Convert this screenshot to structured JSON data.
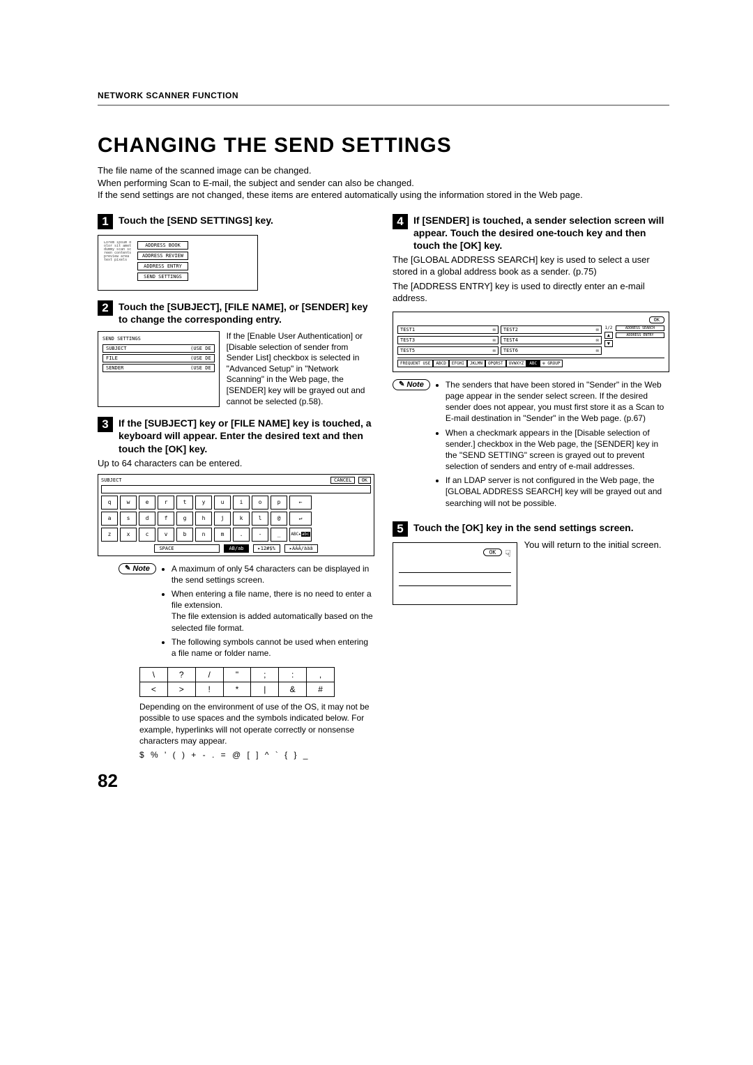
{
  "header": {
    "section": "NETWORK SCANNER FUNCTION"
  },
  "title": "CHANGING THE SEND SETTINGS",
  "intro": {
    "line1": "The file name of the scanned image can be changed.",
    "line2": "When performing Scan to E-mail, the subject and sender can also be changed.",
    "line3": "If the send settings are not changed, these items are entered automatically using the information stored in the Web page."
  },
  "step1": {
    "num": "1",
    "title": "Touch the [SEND SETTINGS] key.",
    "menu": {
      "addressBook": "ADDRESS BOOK",
      "addressReview": "ADDRESS REVIEW",
      "addressEntry": "ADDRESS ENTRY",
      "sendSettings": "SEND SETTINGS"
    }
  },
  "step2": {
    "num": "2",
    "title": "Touch the [SUBJECT], [FILE NAME], or [SENDER] key to change the corresponding entry.",
    "screen": {
      "header": "SEND SETTINGS",
      "subject": "SUBJECT",
      "file": "FILE",
      "sender": "SENDER",
      "placeholder": "(USE DE"
    },
    "text": "If the [Enable User Authentication] or [Disable selection of sender from Sender List] checkbox is selected in \"Advanced Setup\" in \"Network Scanning\" in the Web page, the [SENDER] key will be grayed out and cannot be selected (p.58)."
  },
  "step3": {
    "num": "3",
    "title": "If the [SUBJECT] key or [FILE NAME] key is touched, a keyboard will appear. Enter the desired text and then touch the [OK] key.",
    "caption": "Up to 64 characters can be entered.",
    "keyboard": {
      "title": "SUBJECT",
      "cancel": "CANCEL",
      "ok": "OK",
      "row1": [
        "q",
        "w",
        "e",
        "r",
        "t",
        "y",
        "u",
        "i",
        "o",
        "p"
      ],
      "row2": [
        "a",
        "s",
        "d",
        "f",
        "g",
        "h",
        "j",
        "k",
        "l",
        "@"
      ],
      "row3": [
        "z",
        "x",
        "c",
        "v",
        "b",
        "n",
        "m",
        ".",
        "-",
        "_"
      ],
      "space": "SPACE",
      "mode1": "AB/ab",
      "mode2": "12#$%",
      "mode3": "ÀÄÂ/àäâ",
      "abc": "ABC",
      "abcInv": "abc"
    },
    "note": {
      "label": "Note",
      "items": [
        "A maximum of only 54 characters can be displayed in the send settings screen.",
        "When entering a file name, there is no need to enter a file extension.\nThe file extension is added automatically based on the selected file format.",
        "The following symbols cannot be used when entering a file name or folder name."
      ],
      "symbolsRow1": [
        "\\",
        "?",
        "/",
        "\"",
        ";",
        ":",
        ","
      ],
      "symbolsRow2": [
        "<",
        ">",
        "!",
        "*",
        "|",
        "&",
        "#"
      ],
      "caption": "Depending on the environment of use of the OS, it may not be possible to use spaces and the symbols indicated below. For example, hyperlinks will not operate correctly or nonsense characters may appear.",
      "symbolsLine": "$  %  '  (  )  +  -  .  =  @  [  ]  ^  `  {  }  _"
    }
  },
  "step4": {
    "num": "4",
    "title": "If [SENDER] is touched, a sender selection screen will appear. Touch the desired one-touch key and then touch the [OK] key.",
    "body1": "The [GLOBAL ADDRESS SEARCH] key is used to select a user stored in a global address book as a sender. (p.75)",
    "body2": "The [ADDRESS ENTRY] key is used to directly enter an e-mail address.",
    "screen": {
      "ok": "OK",
      "test1": "TEST1",
      "test2": "TEST2",
      "test3": "TEST3",
      "test4": "TEST4",
      "test5": "TEST5",
      "test6": "TEST6",
      "pager": "1/2",
      "addressSearch": "ADDRESS SEARCH",
      "addressEntry": "ADDRESS ENTRY",
      "tabs": [
        "FREQUENT USE",
        "ABCD",
        "EFGHI",
        "JKLMN",
        "OPQRST",
        "UVWXYZ",
        "ABC",
        "GROUP"
      ]
    },
    "note": {
      "label": "Note",
      "items": [
        "The senders that have been stored in \"Sender\" in the Web page appear in the sender select screen. If the desired sender does not appear, you must first store it as a Scan to E-mail destination in \"Sender\" in the Web page. (p.67)",
        "When a checkmark appears in the [Disable selection of sender.] checkbox in the Web page, the [SENDER] key in the \"SEND SETTING\" screen is grayed out to prevent selection of senders and entry of e-mail addresses.",
        "If an LDAP server is not configured in the Web page, the [GLOBAL ADDRESS SEARCH] key will be grayed out and searching will not be possible."
      ]
    }
  },
  "step5": {
    "num": "5",
    "title": "Touch the [OK] key in the send settings screen.",
    "ok": "OK",
    "text": "You will return to the initial screen."
  },
  "pageNumber": "82"
}
